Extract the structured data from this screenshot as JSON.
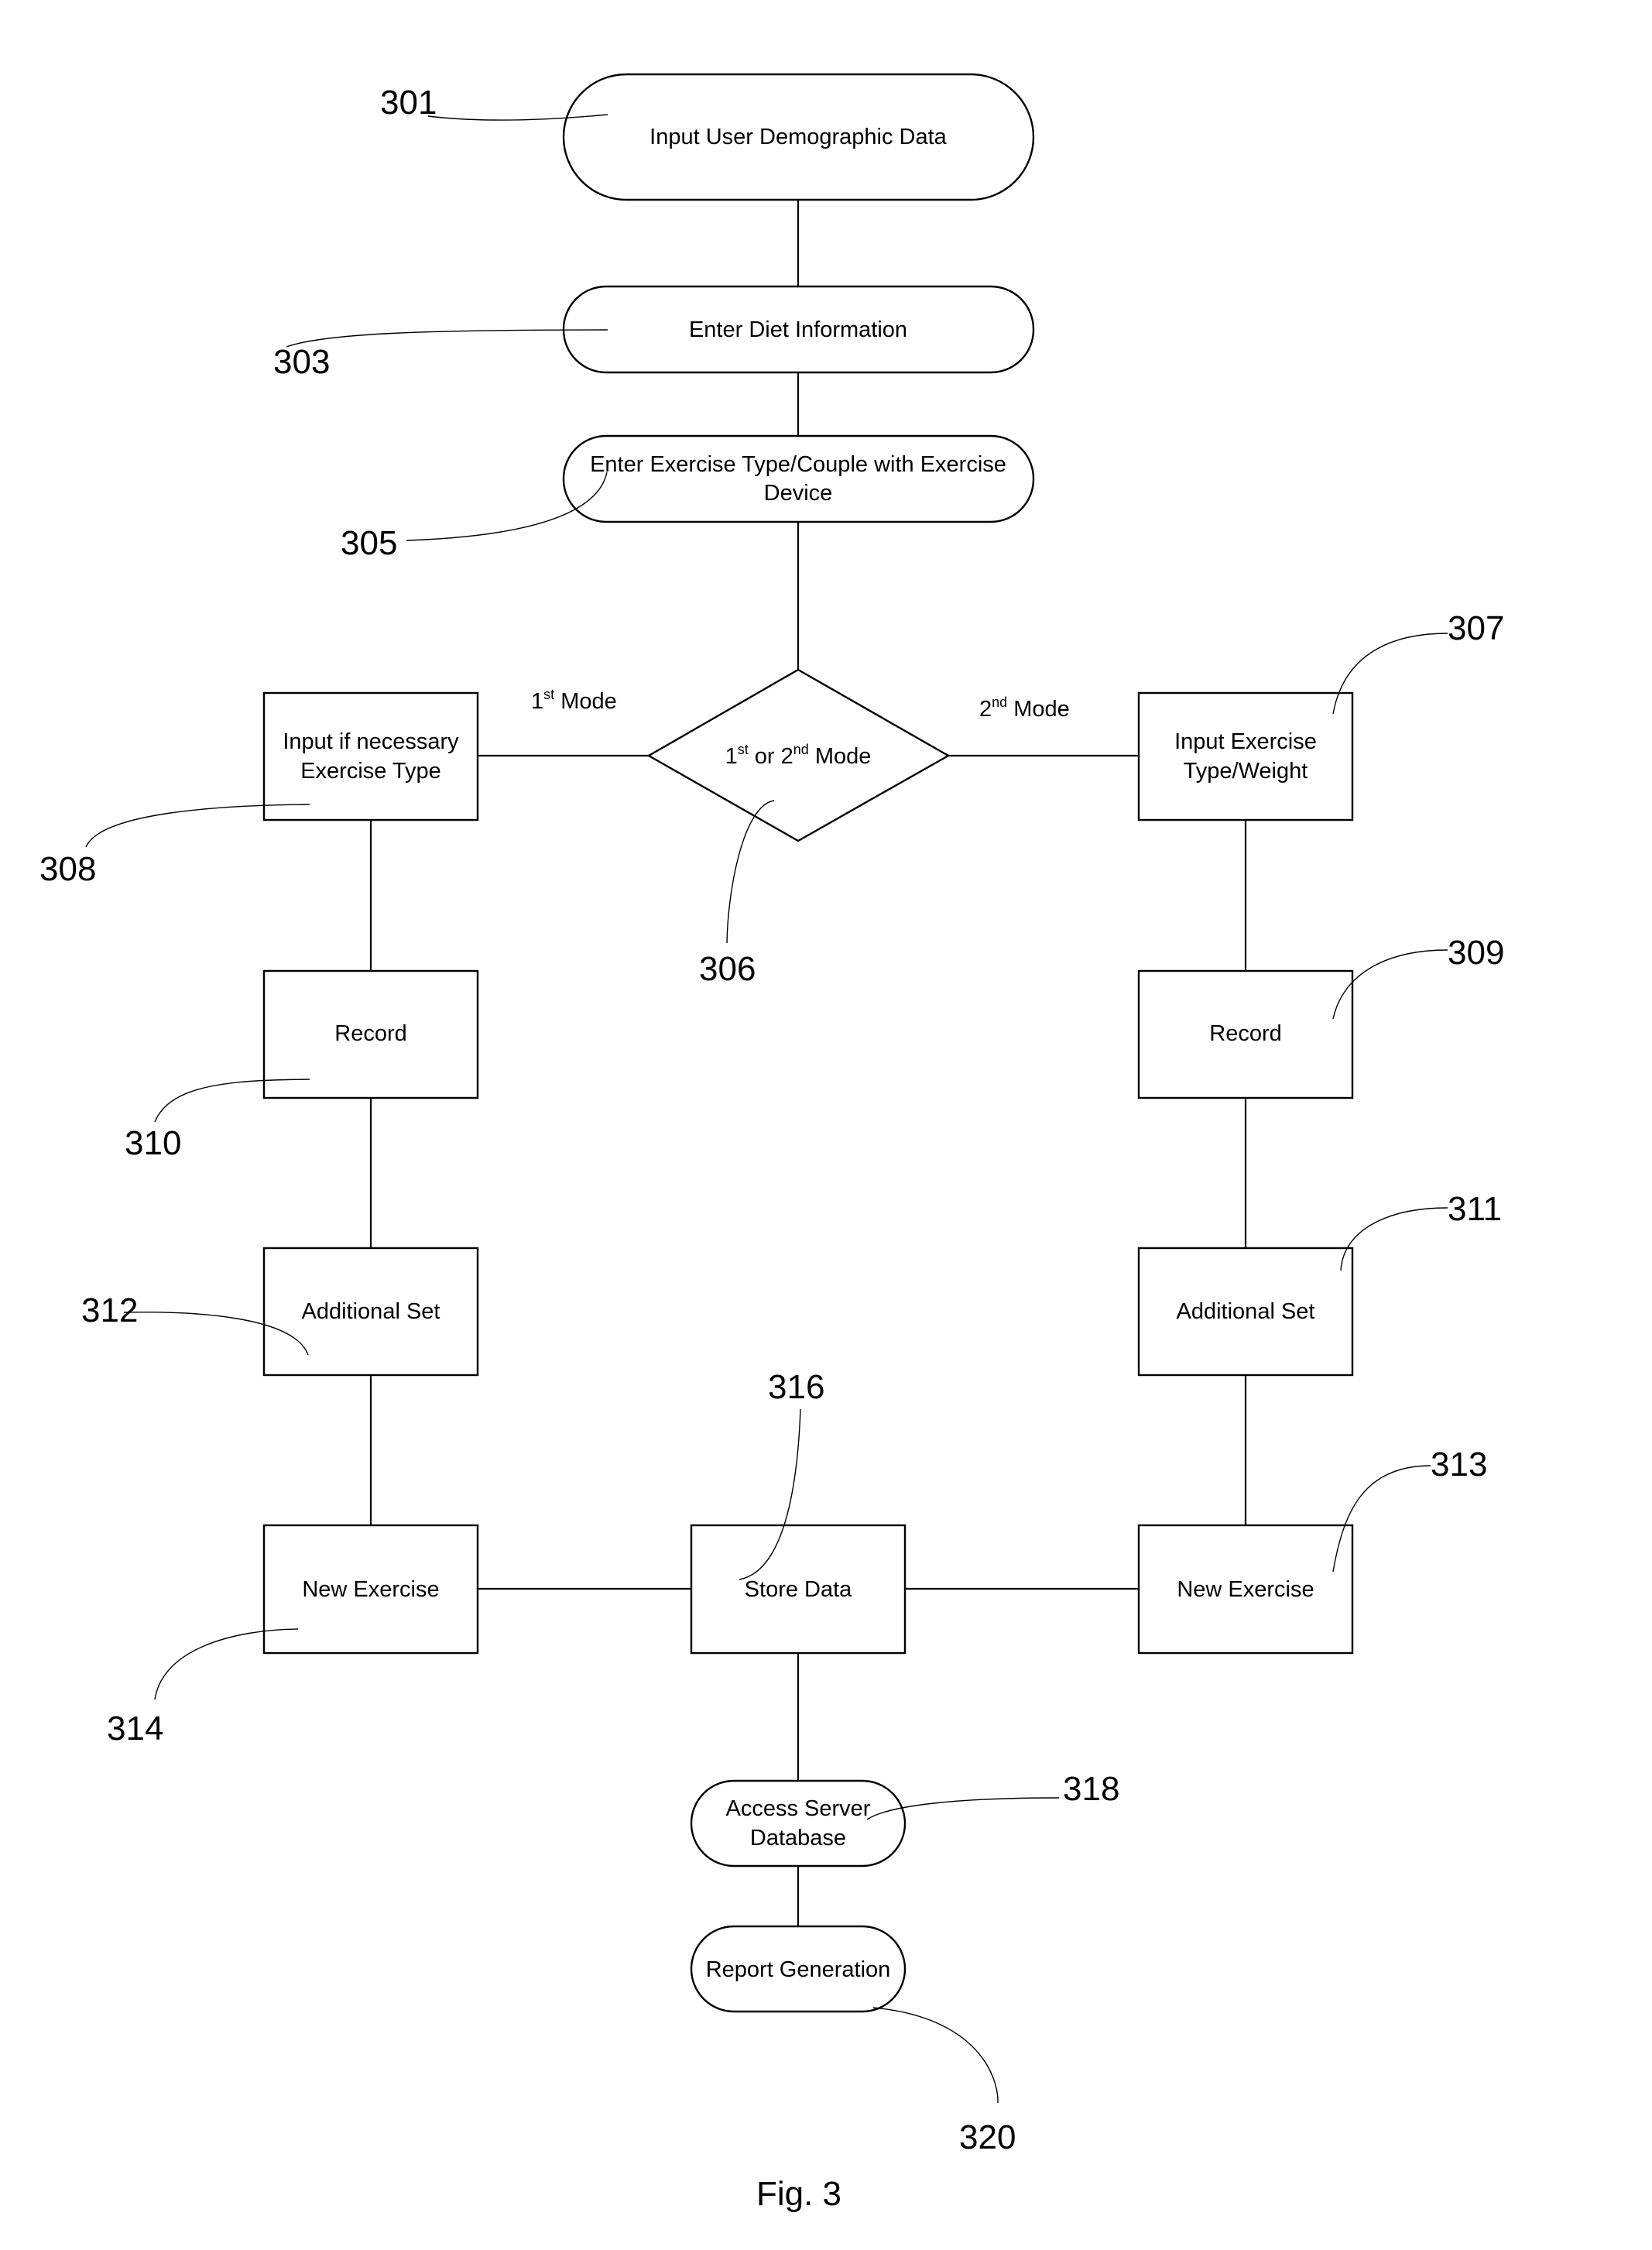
{
  "figure": {
    "caption": "Fig. 3",
    "nodes": {
      "n301": {
        "ref": "301",
        "shape": "terminator",
        "lines": [
          "Input User Demographic Data"
        ]
      },
      "n303": {
        "ref": "303",
        "shape": "terminator",
        "lines": [
          "Enter Diet Information"
        ]
      },
      "n305": {
        "ref": "305",
        "shape": "terminator",
        "lines": [
          "Enter Exercise Type/Couple with Exercise",
          "Device"
        ]
      },
      "n306": {
        "ref": "306",
        "shape": "decision",
        "parts": {
          "a": "1",
          "a_sup": "st",
          "b": " or 2",
          "b_sup": "nd",
          "c": " Mode"
        }
      },
      "n307": {
        "ref": "307",
        "shape": "process",
        "lines": [
          "Input Exercise",
          "Type/Weight"
        ]
      },
      "n308": {
        "ref": "308",
        "shape": "process",
        "lines": [
          "Input if necessary",
          "Exercise Type"
        ]
      },
      "n309": {
        "ref": "309",
        "shape": "process",
        "lines": [
          "Record"
        ]
      },
      "n310": {
        "ref": "310",
        "shape": "process",
        "lines": [
          "Record"
        ]
      },
      "n311": {
        "ref": "311",
        "shape": "process",
        "lines": [
          "Additional Set"
        ]
      },
      "n312": {
        "ref": "312",
        "shape": "process",
        "lines": [
          "Additional Set"
        ]
      },
      "n313": {
        "ref": "313",
        "shape": "process",
        "lines": [
          "New Exercise"
        ]
      },
      "n314": {
        "ref": "314",
        "shape": "process",
        "lines": [
          "New Exercise"
        ]
      },
      "n316": {
        "ref": "316",
        "shape": "process",
        "lines": [
          "Store Data"
        ]
      },
      "n318": {
        "ref": "318",
        "shape": "terminator",
        "lines": [
          "Access Server",
          "Database"
        ]
      },
      "n320": {
        "ref": "320",
        "shape": "terminator",
        "lines": [
          "Report Generation"
        ]
      }
    },
    "branch_labels": {
      "first": {
        "num": "1",
        "sup": "st",
        "text": " Mode"
      },
      "second": {
        "num": "2",
        "sup": "nd",
        "text": " Mode"
      }
    },
    "edges": [
      [
        "n301",
        "n303"
      ],
      [
        "n303",
        "n305"
      ],
      [
        "n305",
        "n306"
      ],
      [
        "n306",
        "n308"
      ],
      [
        "n306",
        "n307"
      ],
      [
        "n308",
        "n310"
      ],
      [
        "n310",
        "n312"
      ],
      [
        "n312",
        "n314"
      ],
      [
        "n307",
        "n309"
      ],
      [
        "n309",
        "n311"
      ],
      [
        "n311",
        "n313"
      ],
      [
        "n314",
        "n316"
      ],
      [
        "n313",
        "n316"
      ],
      [
        "n316",
        "n318"
      ],
      [
        "n318",
        "n320"
      ]
    ]
  }
}
